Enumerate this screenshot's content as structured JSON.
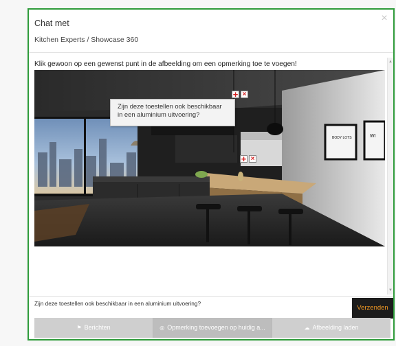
{
  "modal": {
    "title": "Chat met",
    "subtitle": "Kitchen Experts / Showcase 360",
    "close_icon": "close-icon",
    "instruction": "Klik gewoon op een gewenst punt in de afbeelding om een opmerking toe te voegen!"
  },
  "annotations": [
    {
      "id": "annotation-1",
      "tooltip": "Zijn deze toestellen ook beschikbaar in een aluminium uitvoering?"
    },
    {
      "id": "annotation-2",
      "tooltip": ""
    }
  ],
  "tooltip": {
    "line1": "Zijn deze toestellen ook beschikbaar",
    "line2": "in een aluminium uitvoering?"
  },
  "scene": {
    "poster1": "BODY LOTS",
    "poster2": "WI"
  },
  "message": {
    "text": "Zijn deze toestellen ook beschikbaar in een aluminium uitvoering?",
    "send_label": "Verzenden",
    "send_color": "#f59a23"
  },
  "tabs": [
    {
      "icon": "flag-icon",
      "label": "Berichten"
    },
    {
      "icon": "comment-icon",
      "label": "Opmerking toevoegen op huidig a..."
    },
    {
      "icon": "image-icon",
      "label": "Afbeelding laden"
    }
  ],
  "colors": {
    "frame_border": "#2e9b3a",
    "tab_bg": "#cfcfcf",
    "tab_active_bg": "#bdbdbd"
  }
}
